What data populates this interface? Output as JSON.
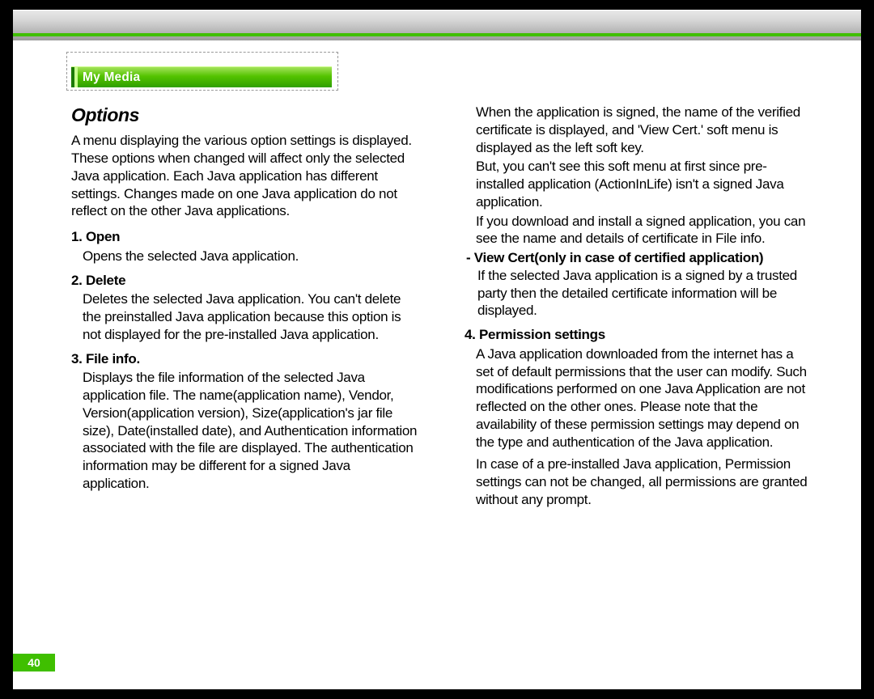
{
  "tab_label": "My Media",
  "page_number": "40",
  "heading": "Options",
  "intro": "A menu displaying the various option settings is displayed. These options when changed will affect only the selected Java application. Each Java application has different settings. Changes made on one Java application do not reflect on the other Java applications.",
  "items": {
    "open": {
      "head": "1. Open",
      "body": "Opens the selected Java application."
    },
    "delete": {
      "head": "2. Delete",
      "body": "Deletes the selected Java application. You can't delete the preinstalled Java application because this option is not displayed for the pre-installed Java application."
    },
    "fileinfo": {
      "head": "3. File info.",
      "body": "Displays the file information of the selected Java application file. The name(application name), Vendor, Version(application version), Size(application's jar file size), Date(installed date), and Authentication information associated with the file are displayed. The authentication information may be different for a signed Java application."
    },
    "right_intro_p1": "When the application is signed, the name of the verified certificate is displayed, and 'View Cert.' soft menu is displayed as the left soft key.",
    "right_intro_p2": "But, you can't see this soft menu at first since pre-installed application (ActionInLife) isn't a signed Java application.",
    "right_intro_p3": "If you download and install a signed application, you can see the name and details of certificate in File info.",
    "viewcert": {
      "head": "- View Cert(only in case of certified application)",
      "body": "If the selected Java application is a signed by a trusted party then the detailed certificate information will be displayed."
    },
    "perm": {
      "head": "4. Permission settings",
      "p1": "A Java application downloaded from the internet has a set of default permissions that the user can modify. Such modifications performed on one Java Application are not reflected on the other ones. Please note that the availability of these permission settings may depend on the type and authentication of the Java application.",
      "p2": "In case of a pre-installed Java application, Permission settings can not be changed, all permissions are granted without any prompt."
    }
  }
}
